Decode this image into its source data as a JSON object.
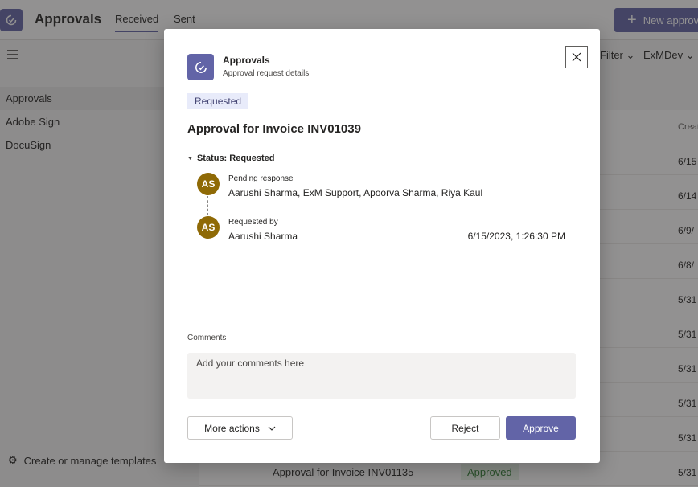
{
  "app": {
    "title": "Approvals",
    "tabs": [
      {
        "label": "Received",
        "active": true
      },
      {
        "label": "Sent",
        "active": false
      }
    ],
    "new_button": "New approval",
    "filter_label": "Filter",
    "environment": "ExMDev",
    "brand_color": "#6264a7"
  },
  "sidebar": {
    "items": [
      {
        "label": "Approvals",
        "active": true
      },
      {
        "label": "Adobe Sign",
        "active": false
      },
      {
        "label": "DocuSign",
        "active": false
      }
    ],
    "templates_link": "Create or manage templates"
  },
  "list": {
    "created_header": "Creat",
    "rows": [
      {
        "date": "6/15"
      },
      {
        "date": "6/14"
      },
      {
        "date": "6/9/"
      },
      {
        "date": "6/8/"
      },
      {
        "date": "5/31"
      },
      {
        "date": "5/31"
      },
      {
        "date": "5/31"
      },
      {
        "date": "5/31"
      },
      {
        "date": "5/31"
      },
      {
        "date": "5/31"
      }
    ],
    "last_row": {
      "title": "Approval for Invoice INV01135",
      "status": "Approved"
    }
  },
  "dialog": {
    "app_name": "Approvals",
    "app_subtitle": "Approval request details",
    "status_pill": "Requested",
    "title": "Approval for Invoice INV01039",
    "status_section": "Status: Requested",
    "pending": {
      "initials": "AS",
      "label": "Pending response",
      "value": "Aarushi Sharma, ExM Support, Apoorva Sharma, Riya Kaul"
    },
    "requested": {
      "initials": "AS",
      "label": "Requested by",
      "value": "Aarushi Sharma",
      "timestamp": "6/15/2023, 1:26:30 PM"
    },
    "comments_label": "Comments",
    "comments_placeholder": "Add your comments here",
    "comments_value": "",
    "buttons": {
      "more_actions": "More actions",
      "reject": "Reject",
      "approve": "Approve"
    }
  }
}
